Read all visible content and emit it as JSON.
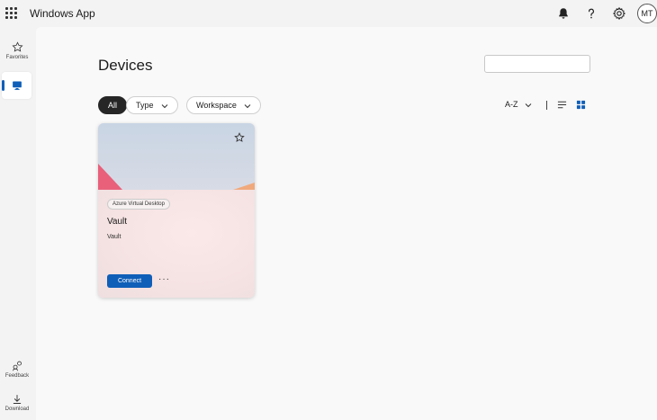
{
  "app": {
    "title": "Windows App",
    "avatar_initials": "MT"
  },
  "sidebar": {
    "items": [
      {
        "id": "favorites",
        "label": "Favorites",
        "icon": "star-icon"
      },
      {
        "id": "devices",
        "label": "",
        "icon": "monitor-icon",
        "active": true
      },
      {
        "id": "feedback",
        "label": "Feedback",
        "icon": "feedback-icon"
      },
      {
        "id": "download",
        "label": "Download",
        "icon": "download-icon"
      }
    ]
  },
  "main": {
    "title": "Devices",
    "search": {
      "placeholder": "",
      "value": ""
    },
    "filters": [
      {
        "label": "All",
        "active": true
      },
      {
        "label": "Type",
        "dropdown": true
      },
      {
        "label": "Workspace",
        "dropdown": true
      }
    ],
    "sort": {
      "label": "A-Z"
    },
    "view_modes": [
      "list-view-icon",
      "grid-view-icon"
    ],
    "cards": [
      {
        "tag": "Azure Virtual Desktop",
        "title": "Vault",
        "subtitle": "Vault",
        "connect_label": "Connect",
        "more_label": "···"
      }
    ]
  },
  "colors": {
    "accent": "#0f5fb8",
    "chip_active": "#262626",
    "background": "#f9f9f9"
  }
}
